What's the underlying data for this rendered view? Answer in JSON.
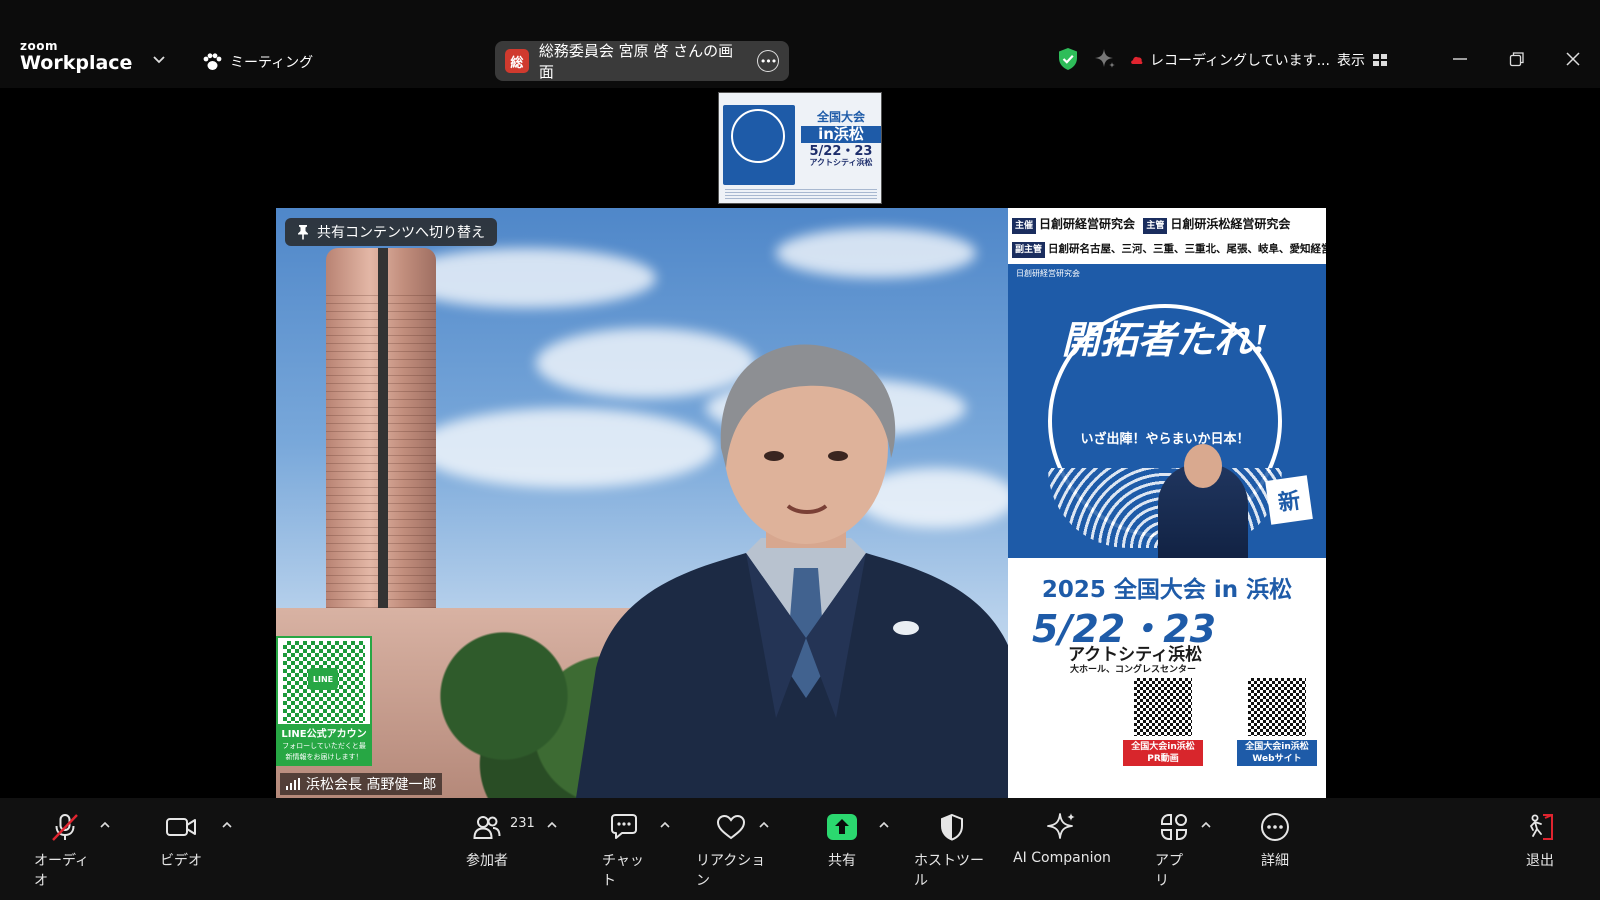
{
  "titlebar": {
    "brand_small": "zoom",
    "brand_big": "Workplace",
    "meeting_label": "ミーティング",
    "sharing_avatar": "総",
    "sharing_label": "総務委員会 宮原 啓 さんの画面",
    "more_label": "•••",
    "recording_label": "レコーディングしています...",
    "view_label": "表示"
  },
  "thumbnail": {
    "t1": "全国大会",
    "t2": "in浜松",
    "t3": "5/22・23",
    "t4": "アクトシティ浜松"
  },
  "video": {
    "switch_label": "共有コンテンツへ切り替え",
    "participant_name": "浜松会長 髙野健一郎",
    "line_qr": {
      "logo": "LINE",
      "title": "LINE公式アカウント",
      "subtitle": "フォローしていただくと最新情報をお届けします！"
    },
    "poster": {
      "header_row1_tag1": "主催",
      "header_row1_org1": "日創研経営研究会",
      "header_row1_tag2": "主管",
      "header_row1_org2": "日創研浜松経営研究会",
      "header_row2_tag": "副主管",
      "header_row2_orgs": "日創研名古屋、三河、三重、三重北、尾張、岐阜、愛知経営研究会",
      "org_small": "日創研経営研究会",
      "title": "開拓者たれ!",
      "slogan": "いざ出陣！やらまいか日本！",
      "kite": "新",
      "year_line": "2025 全国大会 in 浜松",
      "date": "5/22・23",
      "venue": "アクトシティ浜松",
      "venue_sub": "大ホール、コングレスセンター",
      "qr1_label": "全国大会in浜松 PR動画",
      "qr2_label": "全国大会in浜松 Webサイト"
    }
  },
  "toolbar": {
    "audio": "オーディオ",
    "video": "ビデオ",
    "participants": "参加者",
    "participants_count": "231",
    "chat": "チャット",
    "reactions": "リアクション",
    "share": "共有",
    "host_tools": "ホストツール",
    "ai_companion": "AI Companion",
    "apps": "アプリ",
    "more": "詳細",
    "leave": "退出"
  },
  "colors": {
    "share_green": "#2bd86f",
    "mute_red": "#e0242f",
    "shield_green": "#2ebd59",
    "poster_blue": "#1e5ba8"
  }
}
